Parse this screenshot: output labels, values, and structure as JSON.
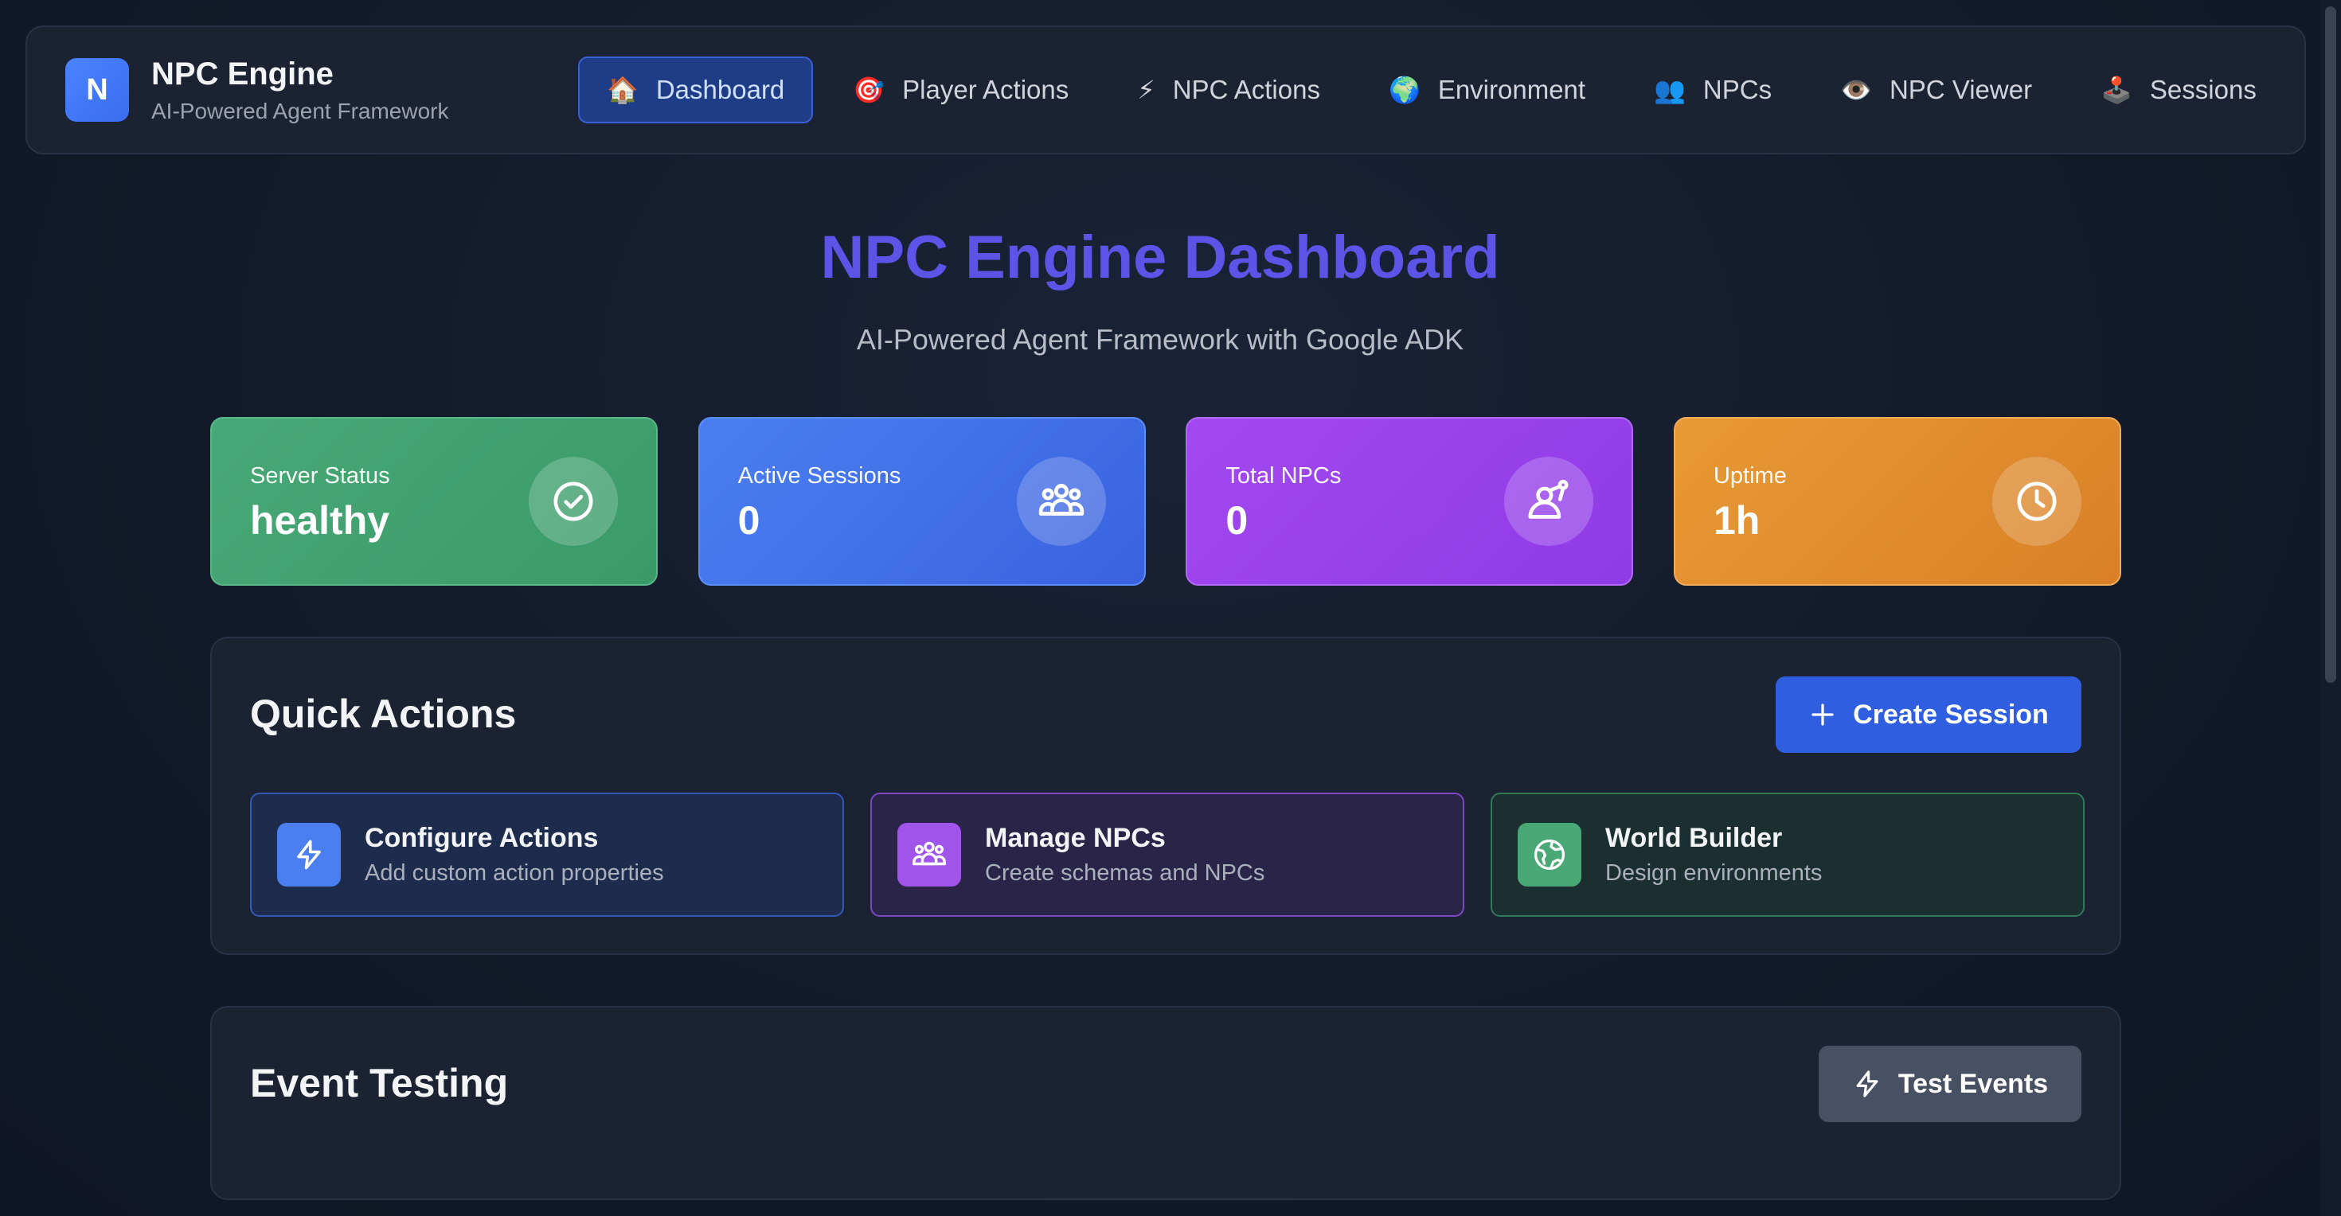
{
  "brand": {
    "logo_letter": "N",
    "title": "NPC Engine",
    "subtitle": "AI-Powered Agent Framework"
  },
  "nav": [
    {
      "icon": "🏠",
      "label": "Dashboard",
      "active": true
    },
    {
      "icon": "🎯",
      "label": "Player Actions"
    },
    {
      "icon": "⚡",
      "label": "NPC Actions"
    },
    {
      "icon": "🌍",
      "label": "Environment"
    },
    {
      "icon": "👥",
      "label": "NPCs"
    },
    {
      "icon": "👁️",
      "label": "NPC Viewer"
    },
    {
      "icon": "🕹️",
      "label": "Sessions"
    }
  ],
  "hero": {
    "title": "NPC Engine Dashboard",
    "subtitle": "AI-Powered Agent Framework with Google ADK"
  },
  "stats": [
    {
      "label": "Server Status",
      "value": "healthy",
      "icon": "check-circle-icon"
    },
    {
      "label": "Active Sessions",
      "value": "0",
      "icon": "users-group-icon"
    },
    {
      "label": "Total NPCs",
      "value": "0",
      "icon": "user-network-icon"
    },
    {
      "label": "Uptime",
      "value": "1h",
      "icon": "clock-icon"
    }
  ],
  "quick_actions": {
    "title": "Quick Actions",
    "create_button": "Create Session",
    "items": [
      {
        "title": "Configure Actions",
        "desc": "Add custom action properties",
        "icon": "lightning-icon"
      },
      {
        "title": "Manage NPCs",
        "desc": "Create schemas and NPCs",
        "icon": "users-group-icon"
      },
      {
        "title": "World Builder",
        "desc": "Design environments",
        "icon": "globe-icon"
      }
    ]
  },
  "event_testing": {
    "title": "Event Testing",
    "test_button": "Test Events"
  },
  "colors": {
    "accent": "#5b54e6",
    "primary_button": "#2f5fe0",
    "server_status": "#47a977",
    "sessions": "#4a7ff0",
    "npcs": "#a348f0",
    "uptime": "#e79a35"
  }
}
